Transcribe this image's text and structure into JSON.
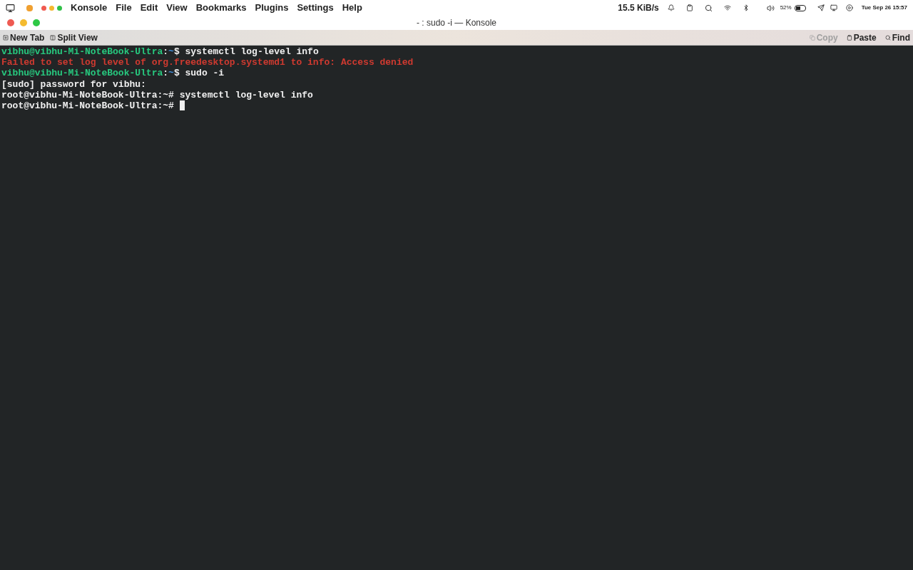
{
  "menu_bar": {
    "app": "Konsole",
    "menus": [
      "File",
      "Edit",
      "View",
      "Bookmarks",
      "Plugins",
      "Settings",
      "Help"
    ],
    "network_speed": "15.5 KiB/s",
    "battery": "52%",
    "clock": "Tue Sep 26 15:57"
  },
  "window": {
    "title": "- : sudo -i — Konsole"
  },
  "toolbar": {
    "left": [
      {
        "label": "New Tab",
        "disabled": false
      },
      {
        "label": "Split View",
        "disabled": false
      }
    ],
    "right": [
      {
        "label": "Copy",
        "disabled": true
      },
      {
        "label": "Paste",
        "disabled": false
      },
      {
        "label": "Find",
        "disabled": false
      }
    ]
  },
  "terminal": {
    "lines": [
      {
        "kind": "user-prompt",
        "user_host": "vibhu@vibhu-Mi-NoteBook-Ultra",
        "separator": ":",
        "path": "~",
        "symbol": "$",
        "command": "systemctl log-level info"
      },
      {
        "kind": "error",
        "text": "Failed to set log level of org.freedesktop.systemd1 to info: Access denied"
      },
      {
        "kind": "user-prompt",
        "user_host": "vibhu@vibhu-Mi-NoteBook-Ultra",
        "separator": ":",
        "path": "~",
        "symbol": "$",
        "command": "sudo -i"
      },
      {
        "kind": "plain",
        "text": "[sudo] password for vibhu:"
      },
      {
        "kind": "root-prompt",
        "prompt": "root@vibhu-Mi-NoteBook-Ultra:~#",
        "command": "systemctl log-level info"
      },
      {
        "kind": "root-prompt",
        "prompt": "root@vibhu-Mi-NoteBook-Ultra:~#",
        "cursor": true
      }
    ]
  }
}
